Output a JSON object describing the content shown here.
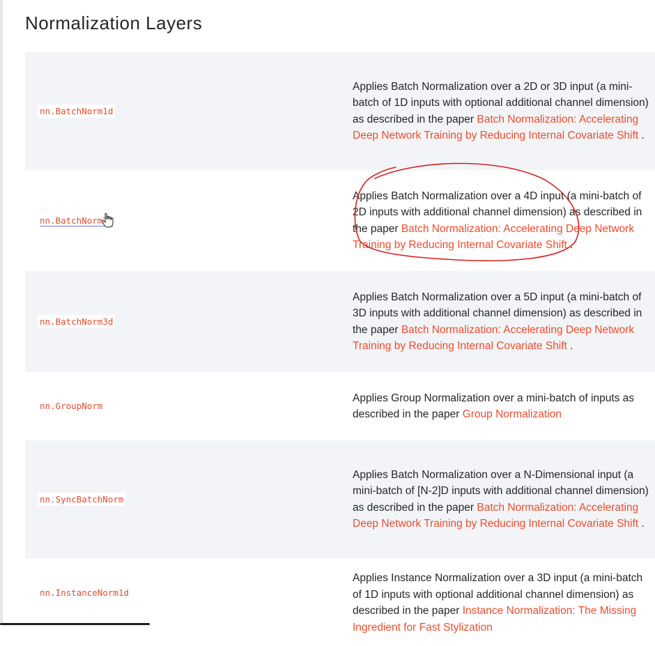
{
  "title": "Normalization Layers",
  "rows": [
    {
      "name": "nn.BatchNorm1d",
      "desc": "Applies Batch Normalization over a 2D or 3D input (a mini-batch of 1D inputs with optional additional channel dimension) as described in the paper",
      "link": "Batch Normalization: Accelerating Deep Network Training by Reducing Internal Covariate Shift",
      "suffix": " ."
    },
    {
      "name": "nn.BatchNorm2d",
      "desc": "Applies Batch Normalization over a 4D input (a mini-batch of 2D inputs with additional channel dimension) as described in the paper",
      "link": "Batch Normalization: Accelerating Deep Network Training by Reducing Internal Covariate Shift",
      "suffix": " ."
    },
    {
      "name": "nn.BatchNorm3d",
      "desc": "Applies Batch Normalization over a 5D input (a mini-batch of 3D inputs with additional channel dimension) as described in the paper",
      "link": "Batch Normalization: Accelerating Deep Network Training by Reducing Internal Covariate Shift",
      "suffix": " ."
    },
    {
      "name": "nn.GroupNorm",
      "desc": "Applies Group Normalization over a mini-batch of inputs as described in the paper",
      "link": "Group Normalization",
      "suffix": ""
    },
    {
      "name": "nn.SyncBatchNorm",
      "desc": "Applies Batch Normalization over a N-Dimensional input (a mini-batch of [N-2]D inputs with additional channel dimension) as described in the paper",
      "link": "Batch Normalization: Accelerating Deep Network Training by Reducing Internal Covariate Shift",
      "suffix": " ."
    },
    {
      "name": "nn.InstanceNorm1d",
      "desc": "Applies Instance Normalization over a 3D input (a mini-batch of 1D inputs with optional additional channel dimension) as described in the paper",
      "link": "Instance Normalization: The Missing Ingredient for Fast Stylization",
      "suffix": ""
    }
  ],
  "colors": {
    "link": "#ee4c2c",
    "shaded_row": "#f3f4f7",
    "annotation": "#d81e1e"
  }
}
